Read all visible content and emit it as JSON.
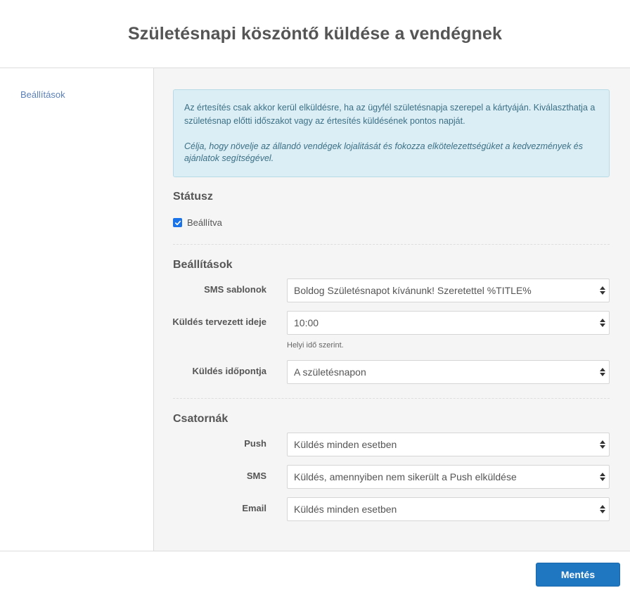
{
  "header": {
    "title": "Születésnapi köszöntő küldése a vendégnek"
  },
  "sidebar": {
    "items": [
      {
        "label": "Beállítások"
      }
    ]
  },
  "info": {
    "text": "Az értesítés csak akkor kerül elküldésre, ha az ügyfél születésnapja szerepel a kártyáján. Kiválaszthatja a születésnap előtti időszakot vagy az értesítés küldésének pontos napját.",
    "italic": "Célja, hogy növelje az állandó vendégek lojalitását és fokozza elkötelezettségüket a kedvezmények és ajánlatok segítségével."
  },
  "status": {
    "title": "Státusz",
    "checkbox_label": "Beállítva",
    "checked": true
  },
  "settings": {
    "title": "Beállítások",
    "sms_template": {
      "label": "SMS sablonok",
      "value": "Boldog Születésnapot kívánunk! Szeretettel %TITLE%"
    },
    "send_time": {
      "label": "Küldés tervezett ideje",
      "value": "10:00",
      "hint": "Helyi idő szerint."
    },
    "send_date": {
      "label": "Küldés időpontja",
      "value": "A születésnapon"
    }
  },
  "channels": {
    "title": "Csatornák",
    "push": {
      "label": "Push",
      "value": "Küldés minden esetben"
    },
    "sms": {
      "label": "SMS",
      "value": "Küldés, amennyiben nem sikerült a Push elküldése"
    },
    "email": {
      "label": "Email",
      "value": "Küldés minden esetben"
    }
  },
  "footer": {
    "save_label": "Mentés"
  },
  "colors": {
    "accent": "#1f77c2",
    "info_bg": "#dbeef5",
    "link": "#5b80b8"
  },
  "icons": {
    "select": "sort-arrows-icon",
    "checkbox": "checkmark-icon"
  }
}
